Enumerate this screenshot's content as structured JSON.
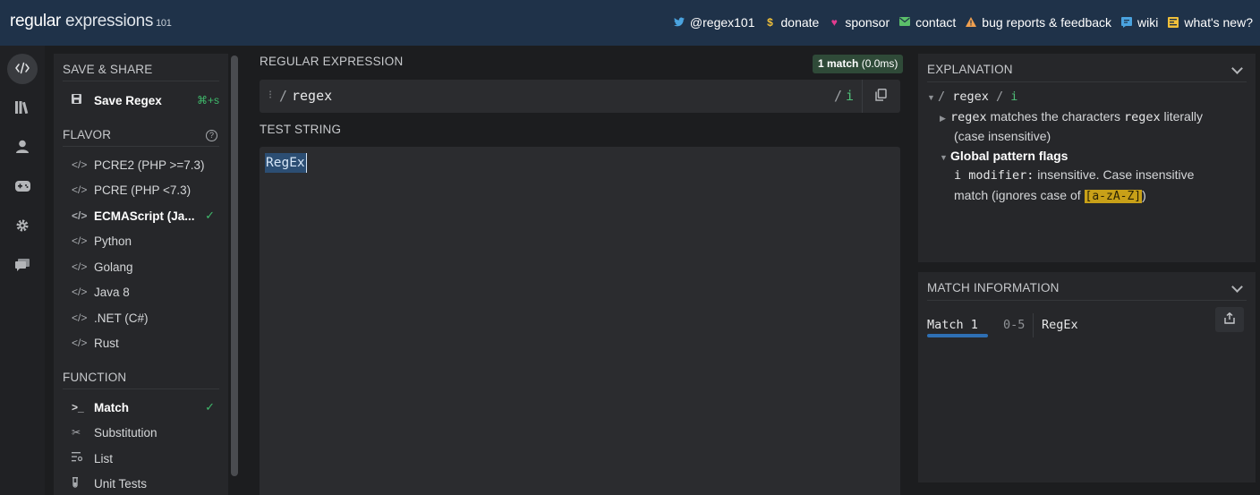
{
  "header": {
    "logo_main": "regular",
    "logo_expr": " expressions",
    "logo_version": "101",
    "nav": [
      {
        "label": "@regex101",
        "icon": "twitter-icon",
        "color": "#4aa3df"
      },
      {
        "label": "donate",
        "icon": "dollar-icon",
        "color": "#f0c03a"
      },
      {
        "label": "sponsor",
        "icon": "heart-icon",
        "color": "#e23c8f"
      },
      {
        "label": "contact",
        "icon": "mail-icon",
        "color": "#5bbf6a"
      },
      {
        "label": "bug reports & feedback",
        "icon": "warning-icon",
        "color": "#f0a050"
      },
      {
        "label": "wiki",
        "icon": "book-icon",
        "color": "#4aa3df"
      },
      {
        "label": "what's new?",
        "icon": "news-icon",
        "color": "#f0c03a"
      }
    ]
  },
  "sidebar": {
    "save_share_title": "SAVE & SHARE",
    "save_regex_label": "Save Regex",
    "save_shortcut": "⌘+s",
    "flavor_title": "FLAVOR",
    "flavors": [
      {
        "label": "PCRE2 (PHP >=7.3)",
        "selected": false
      },
      {
        "label": "PCRE (PHP <7.3)",
        "selected": false
      },
      {
        "label": "ECMAScript (Ja...",
        "selected": true
      },
      {
        "label": "Python",
        "selected": false
      },
      {
        "label": "Golang",
        "selected": false
      },
      {
        "label": "Java 8",
        "selected": false
      },
      {
        "label": ".NET (C#)",
        "selected": false
      },
      {
        "label": "Rust",
        "selected": false
      }
    ],
    "function_title": "FUNCTION",
    "functions": [
      {
        "label": "Match",
        "icon": "terminal-icon",
        "selected": true
      },
      {
        "label": "Substitution",
        "icon": "scissors-icon",
        "selected": false
      },
      {
        "label": "List",
        "icon": "list-icon",
        "selected": false
      },
      {
        "label": "Unit Tests",
        "icon": "flask-icon",
        "selected": false
      }
    ]
  },
  "editor": {
    "regex_title": "REGULAR EXPRESSION",
    "match_badge_bold": "1 match",
    "match_badge_time": " (0.0ms)",
    "regex_delim": "/",
    "regex_value": "regex",
    "flags_delim": "/",
    "flags": "i",
    "test_title": "TEST STRING",
    "test_string": "RegEx"
  },
  "explanation": {
    "title": "EXPLANATION",
    "root_regex": "regex",
    "root_flag": "i",
    "line1_code": "regex",
    "line1_text_a": " matches the characters ",
    "line1_code2": "regex",
    "line1_text_b": " literally",
    "line1_text_c": "(case insensitive)",
    "flags_heading": "Global pattern flags",
    "modifier_label": "i modifier:",
    "modifier_text_a": " insensitive. Case insensitive",
    "modifier_text_b": "match (ignores case of ",
    "modifier_class": "[a-zA-Z]",
    "modifier_text_c": ")"
  },
  "match_info": {
    "title": "MATCH INFORMATION",
    "match_label": "Match 1",
    "range": "0-5",
    "value": "RegEx"
  },
  "colors": {
    "header_bg": "#1f3249",
    "accent_green": "#3fb86b",
    "match_highlight": "#2c4e73",
    "tab_underline": "#2e6fb4"
  }
}
